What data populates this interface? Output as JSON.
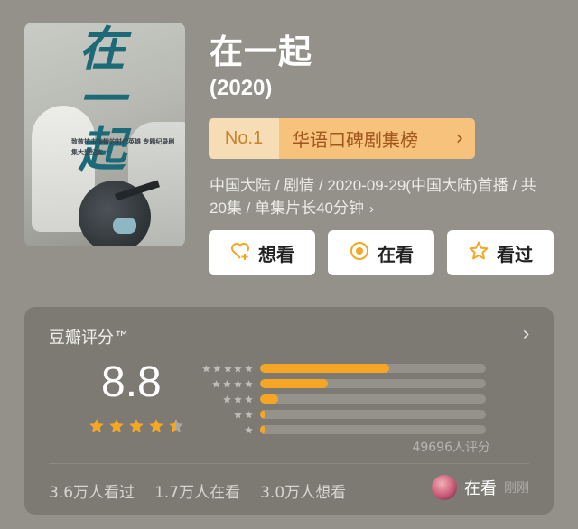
{
  "poster": {
    "title_art": "在一起",
    "tagline": "致敬抗击疫情的时代英雄 专题纪录剧集大型纪实"
  },
  "header": {
    "title": "在一起",
    "year": "(2020)"
  },
  "rank": {
    "number": "No.1",
    "list_name": "华语口碑剧集榜",
    "chevron": "›"
  },
  "meta": {
    "line": "中国大陆 / 剧情 / 2020-09-29(中国大陆)首播 / 共20集 / 单集片长40分钟",
    "more": "›"
  },
  "actions": [
    {
      "label": "想看",
      "icon": "heart-plus-icon"
    },
    {
      "label": "在看",
      "icon": "target-icon"
    },
    {
      "label": "看过",
      "icon": "star-outline-icon"
    }
  ],
  "rating": {
    "title": "豆瓣评分™",
    "score": "8.8",
    "stars": 4.5,
    "histogram": [
      {
        "stars": 5,
        "fraction": 0.57
      },
      {
        "stars": 4,
        "fraction": 0.3
      },
      {
        "stars": 3,
        "fraction": 0.08
      },
      {
        "stars": 2,
        "fraction": 0.01
      },
      {
        "stars": 1,
        "fraction": 0.01
      }
    ],
    "votes": "49696人评分",
    "stats": [
      "3.6万人看过",
      "1.7万人在看",
      "3.0万人想看"
    ],
    "my_status": "在看",
    "my_status_time": "刚刚"
  },
  "colors": {
    "background": "#93918a",
    "card": "#7c7a73",
    "accent": "#f5a623",
    "rank_light": "#f7ddb6",
    "rank_dark": "#f7c27c"
  }
}
